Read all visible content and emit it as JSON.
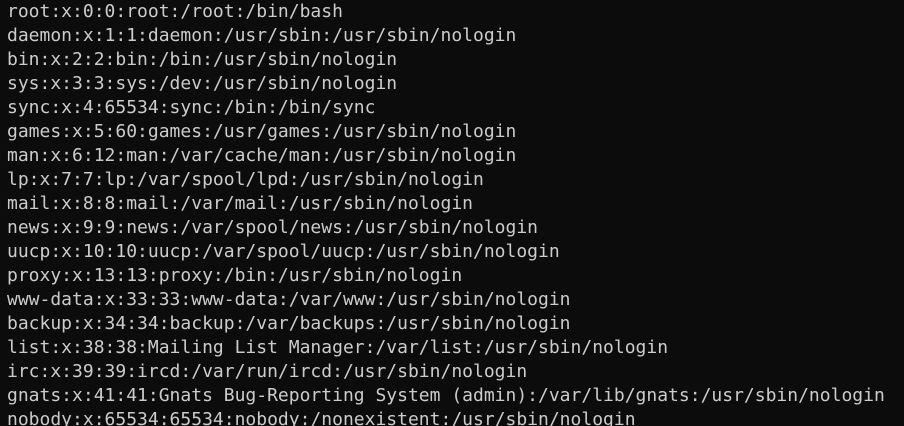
{
  "terminal": {
    "lines": [
      "root:x:0:0:root:/root:/bin/bash",
      "daemon:x:1:1:daemon:/usr/sbin:/usr/sbin/nologin",
      "bin:x:2:2:bin:/bin:/usr/sbin/nologin",
      "sys:x:3:3:sys:/dev:/usr/sbin/nologin",
      "sync:x:4:65534:sync:/bin:/bin/sync",
      "games:x:5:60:games:/usr/games:/usr/sbin/nologin",
      "man:x:6:12:man:/var/cache/man:/usr/sbin/nologin",
      "lp:x:7:7:lp:/var/spool/lpd:/usr/sbin/nologin",
      "mail:x:8:8:mail:/var/mail:/usr/sbin/nologin",
      "news:x:9:9:news:/var/spool/news:/usr/sbin/nologin",
      "uucp:x:10:10:uucp:/var/spool/uucp:/usr/sbin/nologin",
      "proxy:x:13:13:proxy:/bin:/usr/sbin/nologin",
      "www-data:x:33:33:www-data:/var/www:/usr/sbin/nologin",
      "backup:x:34:34:backup:/var/backups:/usr/sbin/nologin",
      "list:x:38:38:Mailing List Manager:/var/list:/usr/sbin/nologin",
      "irc:x:39:39:ircd:/var/run/ircd:/usr/sbin/nologin",
      "gnats:x:41:41:Gnats Bug-Reporting System (admin):/var/lib/gnats:/usr/sbin/nologin",
      "nobody:x:65534:65534:nobody:/nonexistent:/usr/sbin/nologin"
    ]
  }
}
